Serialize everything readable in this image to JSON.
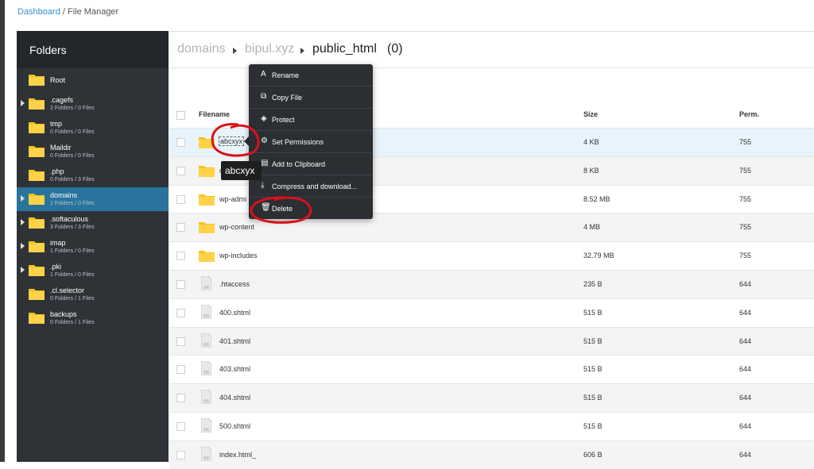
{
  "breadcrumb": {
    "home": "Dashboard",
    "separator": "/",
    "current": "File Manager"
  },
  "sidebar": {
    "title": "Folders",
    "items": [
      {
        "name": "Root",
        "meta": "",
        "caret": false,
        "active": false
      },
      {
        "name": ".cagefs",
        "meta": "2 Folders / 0 Files",
        "caret": true,
        "active": false
      },
      {
        "name": "tmp",
        "meta": "0 Folders / 0 Files",
        "caret": false,
        "active": false
      },
      {
        "name": "Maildir",
        "meta": "0 Folders / 0 Files",
        "caret": false,
        "active": false
      },
      {
        "name": ".php",
        "meta": "0 Folders / 3 Files",
        "caret": false,
        "active": false
      },
      {
        "name": "domains",
        "meta": "1 Folders / 0 Files",
        "caret": true,
        "active": true
      },
      {
        "name": ".softaculous",
        "meta": "3 Folders / 3 Files",
        "caret": true,
        "active": false
      },
      {
        "name": "imap",
        "meta": "1 Folders / 0 Files",
        "caret": true,
        "active": false
      },
      {
        "name": ".pki",
        "meta": "1 Folders / 0 Files",
        "caret": true,
        "active": false
      },
      {
        "name": ".cl.selector",
        "meta": "0 Folders / 1 Files",
        "caret": false,
        "active": false
      },
      {
        "name": "backups",
        "meta": "0 Folders / 1 Files",
        "caret": false,
        "active": false
      }
    ]
  },
  "path": {
    "seg1": "domains",
    "seg2": "bipul.xyz",
    "seg3": "public_html",
    "count": "(0)"
  },
  "table": {
    "headers": {
      "filename": "Filename",
      "size": "Size",
      "perm": "Perm."
    },
    "rows": [
      {
        "type": "folder",
        "name": "abcxyx",
        "size": "4 KB",
        "perm": "755"
      },
      {
        "type": "folder",
        "name": "c",
        "size": "8 KB",
        "perm": "755"
      },
      {
        "type": "folder",
        "name": "wp-admi",
        "size": "8.52 MB",
        "perm": "755"
      },
      {
        "type": "folder",
        "name": "wp-content",
        "size": "4 MB",
        "perm": "755"
      },
      {
        "type": "folder",
        "name": "wp-includes",
        "size": "32.79 MB",
        "perm": "755"
      },
      {
        "type": "file",
        "name": ".htaccess",
        "size": "235 B",
        "perm": "644"
      },
      {
        "type": "file",
        "name": "400.shtml",
        "size": "515 B",
        "perm": "644"
      },
      {
        "type": "file",
        "name": "401.shtml",
        "size": "515 B",
        "perm": "644"
      },
      {
        "type": "file",
        "name": "403.shtml",
        "size": "515 B",
        "perm": "644"
      },
      {
        "type": "file",
        "name": "404.shtml",
        "size": "515 B",
        "perm": "644"
      },
      {
        "type": "file",
        "name": "500.shtml",
        "size": "515 B",
        "perm": "644"
      },
      {
        "type": "file",
        "name": "index.html_",
        "size": "606 B",
        "perm": "644"
      }
    ]
  },
  "context_menu": {
    "items": [
      {
        "icon": "A",
        "label": "Rename"
      },
      {
        "icon": "⧉",
        "label": "Copy File"
      },
      {
        "icon": "◈",
        "label": "Protect"
      },
      {
        "icon": "⚙",
        "label": "Set Permissions"
      },
      {
        "icon": "▤",
        "label": "Add to Clipboard"
      },
      {
        "icon": "⤓",
        "label": "Compress and download..."
      },
      {
        "icon": "🗑",
        "label": "Delete"
      }
    ]
  },
  "tooltip": "abcxyx",
  "colors": {
    "accent": "#28749d",
    "folder": "#f5c518",
    "annotation": "#d8121b"
  }
}
